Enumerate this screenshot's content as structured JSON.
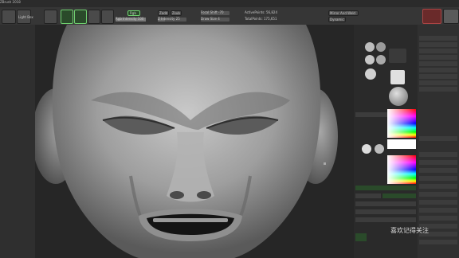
{
  "menubar": {
    "items": [
      "...",
      "...",
      "...",
      "...",
      "...",
      "...",
      "...",
      "...",
      "...",
      "...",
      "...",
      "...",
      "...",
      "...",
      "...",
      "...",
      "...",
      "...",
      "...",
      "...",
      "...",
      "..."
    ],
    "window_title": "ZBrush 2018"
  },
  "toolbar": {
    "left_small": "Light Box",
    "readouts": {
      "rgb": "Rgb",
      "rgb_intensity": "Rgb Intensity 100",
      "zadd": "Zadd",
      "zsub": "Zsub",
      "zintensity": "Z Intensity 25",
      "focal_shift": "Focal Shift -70",
      "draw_size": "Draw Size 4",
      "active_points": "ActivePoints: 56,824",
      "total_points": "TotalPoints: 175,651",
      "mirror_weld": "Mirror And Weld",
      "dynamic": "Dynamic"
    }
  },
  "right_panel": {
    "labels": [
      "Alpha Off",
      "Texture Off",
      "Material",
      "Gradient",
      "SwitchColor",
      "Alternate",
      "Color",
      "Subtool",
      "Layers",
      "Masking",
      "Geometry",
      "Sphere3D",
      "PolyMesh3D",
      "Append",
      "Split",
      "Merge",
      "Remesh",
      "Project",
      "Extract",
      "Sub Palette",
      "Lazy Mouse",
      "Lazy Radius",
      "Activate Symmetry",
      "Add To Spotlight",
      "Layers",
      "Polypaint",
      "Preview",
      "Tool",
      "Focal Shift"
    ]
  },
  "watermark": "喜欢记得关注",
  "colors": {
    "accent_green": "#6fd06f",
    "panel_dark": "#2a2a2a",
    "canvas_bg": "#262626"
  }
}
